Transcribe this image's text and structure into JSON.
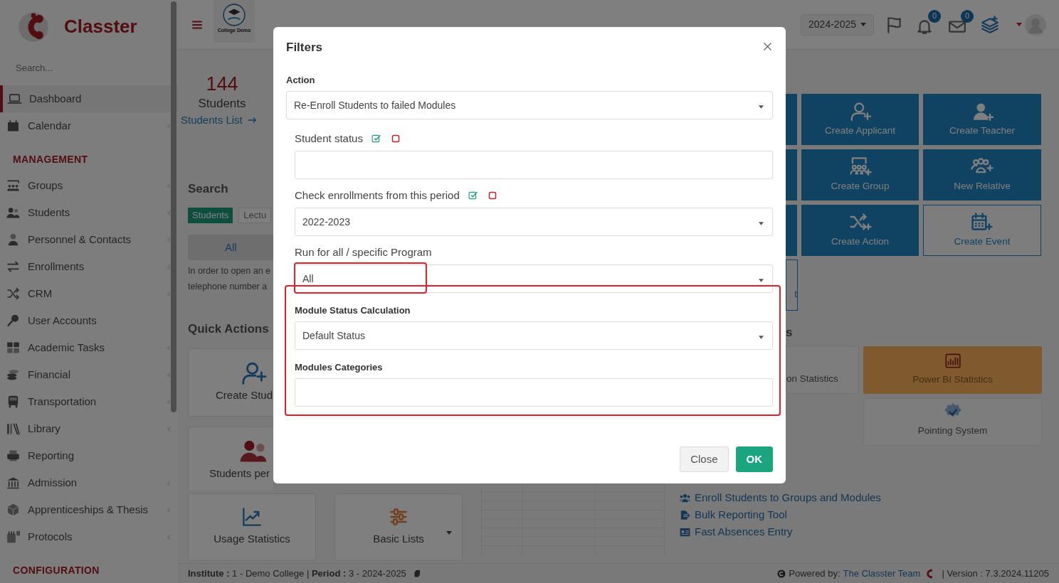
{
  "sidebar": {
    "logo_text": "Classter",
    "search_placeholder": "Search...",
    "items": [
      {
        "kind": "item",
        "label": "Dashboard",
        "selected": true,
        "has_submenu": false
      },
      {
        "kind": "item",
        "label": "Calendar",
        "selected": false,
        "has_submenu": true
      },
      {
        "kind": "section",
        "label": "MANAGEMENT"
      },
      {
        "kind": "item",
        "label": "Groups",
        "selected": false,
        "has_submenu": true
      },
      {
        "kind": "item",
        "label": "Students",
        "selected": false,
        "has_submenu": true
      },
      {
        "kind": "item",
        "label": "Personnel & Contacts",
        "selected": false,
        "has_submenu": true
      },
      {
        "kind": "item",
        "label": "Enrollments",
        "selected": false,
        "has_submenu": true
      },
      {
        "kind": "item",
        "label": "CRM",
        "selected": false,
        "has_submenu": true
      },
      {
        "kind": "item",
        "label": "User Accounts",
        "selected": false,
        "has_submenu": false
      },
      {
        "kind": "item",
        "label": "Academic Tasks",
        "selected": false,
        "has_submenu": true
      },
      {
        "kind": "item",
        "label": "Financial",
        "selected": false,
        "has_submenu": true
      },
      {
        "kind": "item",
        "label": "Transportation",
        "selected": false,
        "has_submenu": true
      },
      {
        "kind": "item",
        "label": "Library",
        "selected": false,
        "has_submenu": true
      },
      {
        "kind": "item",
        "label": "Reporting",
        "selected": false,
        "has_submenu": false
      },
      {
        "kind": "item",
        "label": "Admission",
        "selected": false,
        "has_submenu": true
      },
      {
        "kind": "item",
        "label": "Apprenticeships & Thesis",
        "selected": false,
        "has_submenu": true
      },
      {
        "kind": "item",
        "label": "Protocols",
        "selected": false,
        "has_submenu": true
      },
      {
        "kind": "section",
        "label": "CONFIGURATION"
      }
    ]
  },
  "header": {
    "institute_logo_text": "College Demo",
    "period": "2024-2025",
    "notifications_count": "0",
    "messages_count": "0"
  },
  "summary": {
    "count": "144",
    "label": "Students",
    "link": "Students List"
  },
  "search": {
    "title": "Search",
    "tabs": [
      {
        "label": "Students",
        "selected": true
      },
      {
        "label": "Lectu",
        "selected": false
      }
    ],
    "all_button": "All",
    "hint_lines": [
      "In order to open an e",
      "telephone number a"
    ]
  },
  "quick_actions": {
    "title": "Quick Actions",
    "cards": [
      "Create Stud",
      "Students per"
    ]
  },
  "action_tiles": [
    {
      "label": "Create Applicant",
      "outlined": false
    },
    {
      "label": "Create Teacher",
      "outlined": false
    },
    {
      "label": "Create Group",
      "outlined": false
    },
    {
      "label": "New Relative",
      "outlined": false
    },
    {
      "label": "Create Action",
      "outlined": false
    },
    {
      "label": "Create Event",
      "outlined": true
    }
  ],
  "partial_texts": {
    "tile_end": "t",
    "heading_end": "s"
  },
  "stat_tiles": [
    {
      "label": "on Statistics",
      "highlighted": false
    },
    {
      "label": "Power BI Statistics",
      "highlighted": true
    },
    {
      "label": "Pointing System",
      "highlighted": false
    }
  ],
  "bottom_cards": [
    {
      "label": "Usage Statistics",
      "has_dropdown": false
    },
    {
      "label": "Basic Lists",
      "has_dropdown": true
    }
  ],
  "links": [
    "Enroll Students to Groups and Modules",
    "Bulk Reporting Tool",
    "Fast Absences Entry"
  ],
  "footer": {
    "left": "**Institute :** 1 - Demo College | **Period :** 3 - 2024-2025",
    "powered_by": "Powered by:",
    "team_link": "The Classter Team",
    "version": "| Version : 7.3.2024.11205"
  },
  "modal": {
    "title": "Filters",
    "sections": [
      {
        "annotated": false,
        "fields": [
          {
            "kind": "select",
            "label": "Action",
            "value": "Re-Enroll Students to failed Modules",
            "bulk_toggles": false,
            "value_annotated": false
          }
        ]
      },
      {
        "annotated": false,
        "fields": [
          {
            "kind": "multi",
            "label": "Student status",
            "bulk_toggles": true,
            "value_annotated": false
          },
          {
            "kind": "select",
            "label": "Check enrollments from this period",
            "value": "2022-2023",
            "bulk_toggles": true,
            "value_annotated": false
          },
          {
            "kind": "select",
            "label": "Run for all / specific Program",
            "value": "All",
            "bulk_toggles": false,
            "value_annotated": true
          }
        ]
      },
      {
        "annotated": true,
        "fields": [
          {
            "kind": "select",
            "label": "Module Status Calculation",
            "value": "Default Status",
            "bulk_toggles": false,
            "value_annotated": false
          },
          {
            "kind": "multi",
            "label": "Modules Categories",
            "bulk_toggles": false,
            "value_annotated": false
          }
        ]
      }
    ],
    "buttons": [
      {
        "label": "Close",
        "kind": "secondary"
      },
      {
        "label": "OK",
        "kind": "primary"
      }
    ]
  }
}
